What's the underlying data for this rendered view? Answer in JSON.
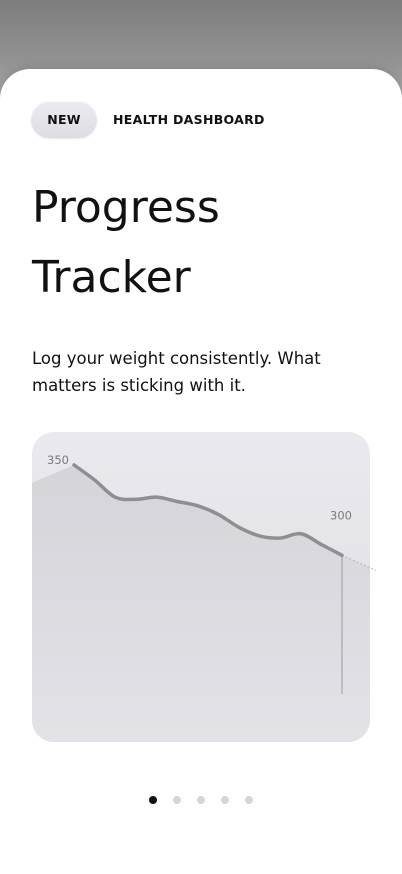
{
  "badge": {
    "label": "NEW"
  },
  "eyebrow": "HEALTH DASHBOARD",
  "title": {
    "line1": "Progress",
    "line2": "Tracker"
  },
  "subtitle": "Log your weight consistently. What matters is sticking with it.",
  "chart_data": {
    "type": "line",
    "annotations": [
      {
        "label": "350",
        "value": 350,
        "position": "start"
      },
      {
        "label": "300",
        "value": 300,
        "position": "end"
      }
    ],
    "values": [
      350,
      343,
      335,
      334,
      335,
      333,
      331,
      327,
      321,
      317,
      316,
      318,
      313,
      308
    ],
    "ylim": [
      290,
      356
    ],
    "colors": {
      "line": "#8e8e93",
      "area_top": "#d4d4d9",
      "area_bottom": "#e2e2e7",
      "marker": "#9a9a9f"
    }
  },
  "pager": {
    "count": 5,
    "active": 0
  }
}
